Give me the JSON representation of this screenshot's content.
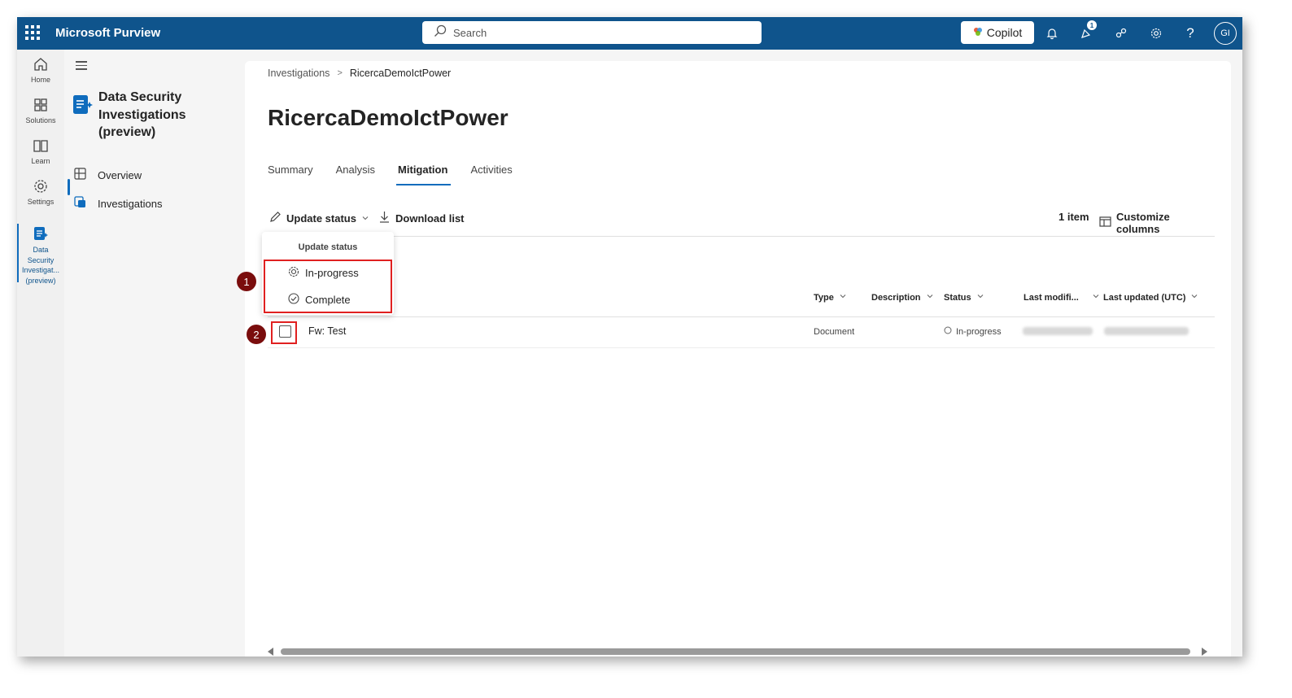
{
  "app": {
    "name": "Microsoft Purview"
  },
  "search": {
    "placeholder": "Search"
  },
  "header": {
    "copilot_label": "Copilot",
    "notification_count": "1",
    "avatar_initials": "GI",
    "help_glyph": "?"
  },
  "rail": {
    "items": [
      {
        "label": "Home",
        "icon": "home-icon"
      },
      {
        "label": "Solutions",
        "icon": "solutions-icon"
      },
      {
        "label": "Learn",
        "icon": "book-icon"
      },
      {
        "label": "Settings",
        "icon": "gear-icon"
      }
    ],
    "active": {
      "line1": "Data",
      "line2": "Security",
      "line3": "Investigat...",
      "line4": "(preview)"
    }
  },
  "nav": {
    "title": "Data Security Investigations (preview)",
    "items": [
      {
        "label": "Overview",
        "icon": "overview-icon"
      },
      {
        "label": "Investigations",
        "icon": "investigations-icon",
        "selected": true
      }
    ]
  },
  "breadcrumb": {
    "parent": "Investigations",
    "separator": ">",
    "current": "RicercaDemoIctPower"
  },
  "page": {
    "title": "RicercaDemoIctPower"
  },
  "tabs": [
    {
      "label": "Summary"
    },
    {
      "label": "Analysis"
    },
    {
      "label": "Mitigation",
      "active": true
    },
    {
      "label": "Activities"
    }
  ],
  "toolbar": {
    "update_status_label": "Update status",
    "download_label": "Download list",
    "item_count": "1 item",
    "customize_label": "Customize columns"
  },
  "status_menu": {
    "heading": "Update status",
    "options": [
      "In-progress",
      "Complete"
    ]
  },
  "callouts": [
    "1",
    "2"
  ],
  "table": {
    "columns": [
      "Type",
      "Description",
      "Status",
      "Last modifi...",
      "Last updated (UTC)"
    ],
    "rows": [
      {
        "name": "Fw: Test",
        "type": "Document",
        "description": "",
        "status": "In-progress"
      }
    ]
  },
  "colors": {
    "header_bg": "#0f548c",
    "accent": "#0f6cbd",
    "highlight": "#e02020",
    "callout": "#7a0d0d"
  }
}
